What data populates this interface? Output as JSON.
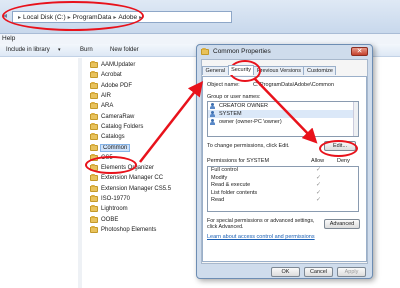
{
  "explorer": {
    "breadcrumb": [
      "Local Disk (C:)",
      "ProgramData",
      "Adobe"
    ],
    "menu": {
      "help": "Help"
    },
    "toolbar": {
      "include_library": "Include in library",
      "burn": "Burn",
      "new_folder": "New folder"
    },
    "folders": [
      {
        "name": "AAMUpdater"
      },
      {
        "name": "Acrobat"
      },
      {
        "name": "Adobe PDF"
      },
      {
        "name": "AIR"
      },
      {
        "name": "ARA"
      },
      {
        "name": "CameraRaw"
      },
      {
        "name": "Catalog Folders"
      },
      {
        "name": "Catalogs"
      },
      {
        "name": "Common",
        "selected": true
      },
      {
        "name": "CS5"
      },
      {
        "name": "Elements Organizer"
      },
      {
        "name": "Extension Manager CC"
      },
      {
        "name": "Extension Manager CS5.5"
      },
      {
        "name": "ISO-19770"
      },
      {
        "name": "Lightroom"
      },
      {
        "name": "OOBE"
      },
      {
        "name": "Photoshop Elements"
      }
    ]
  },
  "dialog": {
    "title": "Common Properties",
    "tabs": [
      "General",
      "Security",
      "Previous Versions",
      "Customize"
    ],
    "active_tab": "Security",
    "object_name_label": "Object name:",
    "object_name_value": "C:\\ProgramData\\Adobe\\Common",
    "groups_label": "Group or user names:",
    "groups": [
      "CREATOR OWNER",
      "SYSTEM",
      "owner (owner-PC      \\owner)"
    ],
    "change_perm_text": "To change permissions, click Edit.",
    "edit_button": "Edit...",
    "permissions_for": "Permissions for SYSTEM",
    "allow_label": "Allow",
    "deny_label": "Deny",
    "permissions": [
      {
        "name": "Full control",
        "allow": true
      },
      {
        "name": "Modify",
        "allow": true
      },
      {
        "name": "Read & execute",
        "allow": true
      },
      {
        "name": "List folder contents",
        "allow": true
      },
      {
        "name": "Read",
        "allow": true
      }
    ],
    "special_text": "For special permissions or advanced settings, click Advanced.",
    "advanced_button": "Advanced",
    "link_text": "Learn about access control and permissions",
    "ok": "OK",
    "cancel": "Cancel",
    "apply": "Apply",
    "check_glyph": "✓"
  },
  "colors": {
    "annotation": "#e8121b",
    "selection": "#cfe3fb"
  }
}
